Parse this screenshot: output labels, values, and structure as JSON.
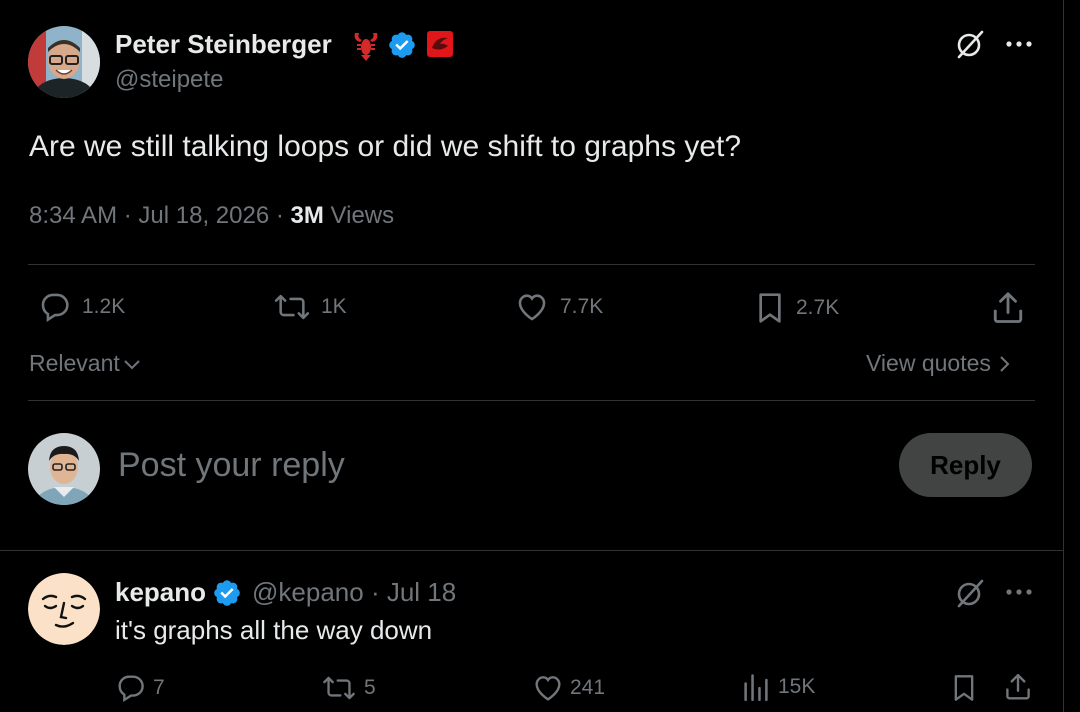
{
  "tweet": {
    "author_name": "Peter Steinberger",
    "author_handle": "@steipete",
    "text": "Are we still talking loops or did we shift to graphs yet?",
    "time": "8:34 AM",
    "date": "Jul 18, 2026",
    "views_count": "3M",
    "views_label": "Views",
    "replies": "1.2K",
    "reposts": "1K",
    "likes": "7.7K",
    "bookmarks": "2.7K"
  },
  "sort": {
    "label": "Relevant",
    "view_quotes": "View quotes"
  },
  "composer": {
    "placeholder": "Post your reply",
    "button": "Reply"
  },
  "reply": {
    "author_name": "kepano",
    "author_handle": "@kepano",
    "date": "Jul 18",
    "text": "it's graphs all the way down",
    "replies": "7",
    "reposts": "5",
    "likes": "241",
    "views": "15K"
  },
  "colors": {
    "background": "#000000",
    "text": "#e7e9ea",
    "muted": "#71767b",
    "verified": "#1d9bf0",
    "divider": "#2f3336"
  },
  "icons": [
    "lobster-icon",
    "verified-icon",
    "red-badge-icon",
    "grok-icon",
    "more-icon",
    "reply-icon",
    "repost-icon",
    "like-icon",
    "bookmark-icon",
    "share-icon",
    "views-icon",
    "chevron-down-icon",
    "chevron-right-icon"
  ]
}
